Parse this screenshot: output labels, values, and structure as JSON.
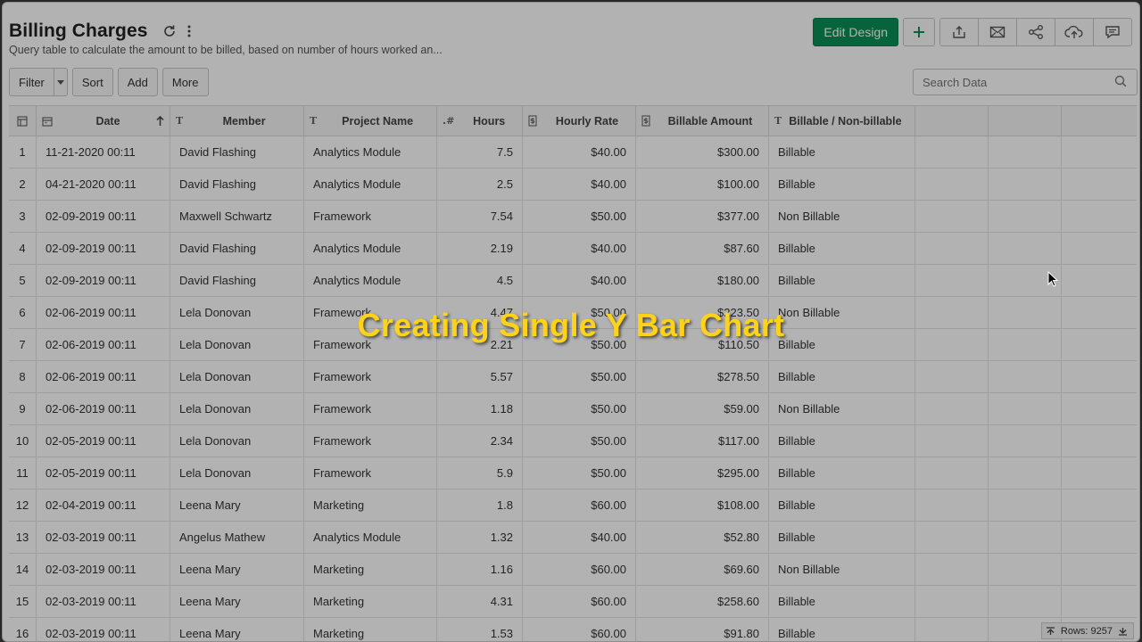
{
  "header": {
    "title": "Billing Charges",
    "subtitle": "Query table to calculate the amount to be billed, based on number of hours worked an...",
    "edit_design_label": "Edit Design"
  },
  "toolbar": {
    "filter_label": "Filter",
    "sort_label": "Sort",
    "add_label": "Add",
    "more_label": "More",
    "search_placeholder": "Search Data"
  },
  "table": {
    "columns": [
      "Date",
      "Member",
      "Project Name",
      "Hours",
      "Hourly Rate",
      "Billable Amount",
      "Billable / Non-billable"
    ],
    "rows": [
      {
        "n": "1",
        "date": "11-21-2020 00:11",
        "member": "David Flashing",
        "project": "Analytics Module",
        "hours": "7.5",
        "rate": "$40.00",
        "amount": "$300.00",
        "billable": "Billable"
      },
      {
        "n": "2",
        "date": "04-21-2020 00:11",
        "member": "David Flashing",
        "project": "Analytics Module",
        "hours": "2.5",
        "rate": "$40.00",
        "amount": "$100.00",
        "billable": "Billable"
      },
      {
        "n": "3",
        "date": "02-09-2019 00:11",
        "member": "Maxwell Schwartz",
        "project": "Framework",
        "hours": "7.54",
        "rate": "$50.00",
        "amount": "$377.00",
        "billable": "Non Billable"
      },
      {
        "n": "4",
        "date": "02-09-2019 00:11",
        "member": "David Flashing",
        "project": "Analytics Module",
        "hours": "2.19",
        "rate": "$40.00",
        "amount": "$87.60",
        "billable": "Billable"
      },
      {
        "n": "5",
        "date": "02-09-2019 00:11",
        "member": "David Flashing",
        "project": "Analytics Module",
        "hours": "4.5",
        "rate": "$40.00",
        "amount": "$180.00",
        "billable": "Billable"
      },
      {
        "n": "6",
        "date": "02-06-2019 00:11",
        "member": "Lela Donovan",
        "project": "Framework",
        "hours": "4.47",
        "rate": "$50.00",
        "amount": "$223.50",
        "billable": "Non Billable"
      },
      {
        "n": "7",
        "date": "02-06-2019 00:11",
        "member": "Lela Donovan",
        "project": "Framework",
        "hours": "2.21",
        "rate": "$50.00",
        "amount": "$110.50",
        "billable": "Billable"
      },
      {
        "n": "8",
        "date": "02-06-2019 00:11",
        "member": "Lela Donovan",
        "project": "Framework",
        "hours": "5.57",
        "rate": "$50.00",
        "amount": "$278.50",
        "billable": "Billable"
      },
      {
        "n": "9",
        "date": "02-06-2019 00:11",
        "member": "Lela Donovan",
        "project": "Framework",
        "hours": "1.18",
        "rate": "$50.00",
        "amount": "$59.00",
        "billable": "Non Billable"
      },
      {
        "n": "10",
        "date": "02-05-2019 00:11",
        "member": "Lela Donovan",
        "project": "Framework",
        "hours": "2.34",
        "rate": "$50.00",
        "amount": "$117.00",
        "billable": "Billable"
      },
      {
        "n": "11",
        "date": "02-05-2019 00:11",
        "member": "Lela Donovan",
        "project": "Framework",
        "hours": "5.9",
        "rate": "$50.00",
        "amount": "$295.00",
        "billable": "Billable"
      },
      {
        "n": "12",
        "date": "02-04-2019 00:11",
        "member": "Leena Mary",
        "project": "Marketing",
        "hours": "1.8",
        "rate": "$60.00",
        "amount": "$108.00",
        "billable": "Billable"
      },
      {
        "n": "13",
        "date": "02-03-2019 00:11",
        "member": "Angelus Mathew",
        "project": "Analytics Module",
        "hours": "1.32",
        "rate": "$40.00",
        "amount": "$52.80",
        "billable": "Billable"
      },
      {
        "n": "14",
        "date": "02-03-2019 00:11",
        "member": "Leena Mary",
        "project": "Marketing",
        "hours": "1.16",
        "rate": "$60.00",
        "amount": "$69.60",
        "billable": "Non Billable"
      },
      {
        "n": "15",
        "date": "02-03-2019 00:11",
        "member": "Leena Mary",
        "project": "Marketing",
        "hours": "4.31",
        "rate": "$60.00",
        "amount": "$258.60",
        "billable": "Billable"
      },
      {
        "n": "16",
        "date": "02-03-2019 00:11",
        "member": "Leena Mary",
        "project": "Marketing",
        "hours": "1.53",
        "rate": "$60.00",
        "amount": "$91.80",
        "billable": "Billable"
      }
    ]
  },
  "footer": {
    "rows_label": "Rows: 9257"
  },
  "overlay": {
    "caption": "Creating Single Y Bar Chart"
  },
  "colors": {
    "accent": "#0a8f55",
    "caption": "#ffd21a"
  }
}
